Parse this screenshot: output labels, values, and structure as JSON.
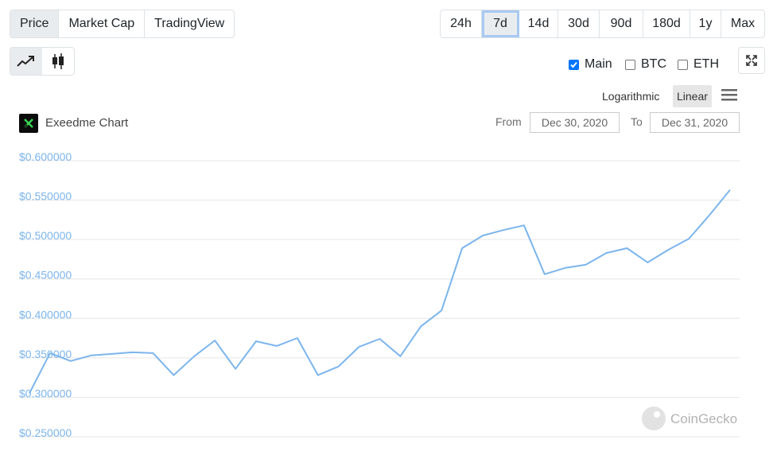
{
  "tabs": [
    {
      "label": "Price",
      "active": true
    },
    {
      "label": "Market Cap",
      "active": false
    },
    {
      "label": "TradingView",
      "active": false
    }
  ],
  "ranges": [
    {
      "label": "24h",
      "active": false
    },
    {
      "label": "7d",
      "active": true
    },
    {
      "label": "14d",
      "active": false
    },
    {
      "label": "30d",
      "active": false
    },
    {
      "label": "90d",
      "active": false
    },
    {
      "label": "180d",
      "active": false
    },
    {
      "label": "1y",
      "active": false
    },
    {
      "label": "Max",
      "active": false
    }
  ],
  "chart_types": [
    {
      "icon": "line-chart-icon",
      "active": true
    },
    {
      "icon": "candlestick-icon",
      "active": false
    }
  ],
  "compare": [
    {
      "label": "Main",
      "checked": true
    },
    {
      "label": "BTC",
      "checked": false
    },
    {
      "label": "ETH",
      "checked": false
    }
  ],
  "scale": {
    "logarithmic": "Logarithmic",
    "linear": "Linear",
    "active": "Linear"
  },
  "chart_title": "Exeedme Chart",
  "date_range": {
    "from_label": "From",
    "from": "Dec 30, 2020",
    "to_label": "To",
    "to": "Dec 31, 2020"
  },
  "watermark": "CoinGecko",
  "colors": {
    "line": "#7cb5ec",
    "axis_label": "#7cb5ec",
    "grid": "#e6e6e6",
    "active_outline": "#a8c9f3"
  },
  "chart_data": {
    "type": "line",
    "title": "Exeedme Chart",
    "xlabel": "",
    "ylabel": "",
    "ylim": [
      0.25,
      0.6
    ],
    "y_ticks": [
      "$0.600000",
      "$0.550000",
      "$0.500000",
      "$0.450000",
      "$0.400000",
      "$0.350000",
      "$0.300000",
      "$0.250000"
    ],
    "y_tick_values": [
      0.6,
      0.55,
      0.5,
      0.45,
      0.4,
      0.35,
      0.3,
      0.25
    ],
    "grid": true,
    "series": [
      {
        "values": [
          0.3,
          0.351,
          0.341,
          0.348,
          0.35,
          0.352,
          0.351,
          0.323,
          0.347,
          0.367,
          0.331,
          0.366,
          0.36,
          0.37,
          0.323,
          0.334,
          0.359,
          0.369,
          0.347,
          0.385,
          0.405,
          0.484,
          0.5,
          0.507,
          0.513,
          0.451,
          0.459,
          0.463,
          0.478,
          0.484,
          0.466,
          0.482,
          0.496,
          0.526,
          0.558
        ]
      }
    ]
  }
}
